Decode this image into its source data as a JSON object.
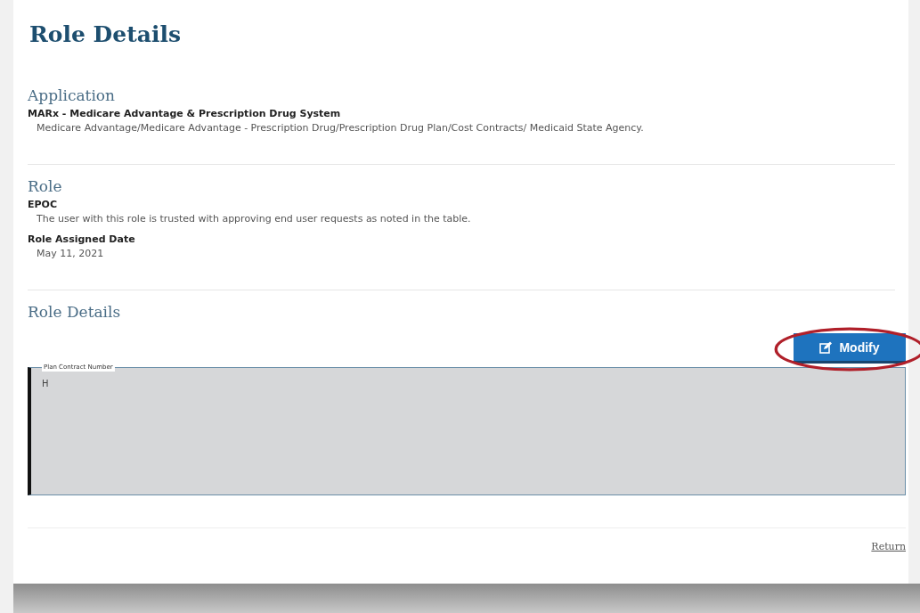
{
  "page_title": "Role Details",
  "application": {
    "heading": "Application",
    "name": "MARx - Medicare Advantage & Prescription Drug System",
    "description": "Medicare Advantage/Medicare Advantage - Prescription Drug/Prescription Drug Plan/Cost Contracts/ Medicaid State Agency."
  },
  "role": {
    "heading": "Role",
    "name": "EPOC",
    "description": "The user with this role is trusted with approving end user requests as noted in the table.",
    "date_label": "Role Assigned Date",
    "date": "May 11, 2021"
  },
  "role_details": {
    "heading": "Role Details",
    "modify_button": "Modify",
    "field": {
      "label": "Plan Contract Number",
      "value": "H"
    }
  },
  "return_link": "Return"
}
